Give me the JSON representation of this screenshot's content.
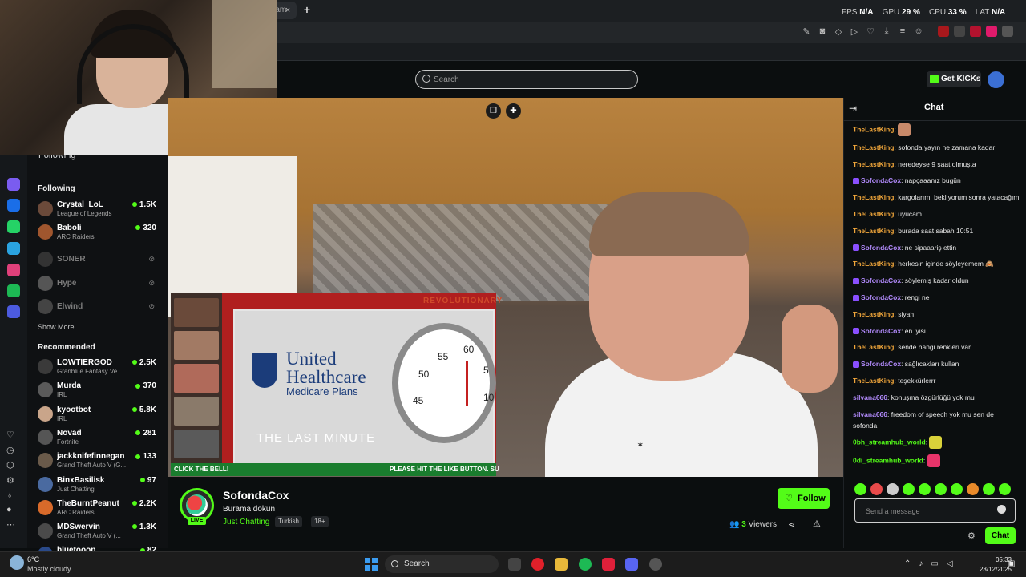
{
  "browser": {
    "tab_label": "ram",
    "tab_close": "×",
    "new_tab": "+",
    "stats": {
      "fps_label": "FPS",
      "fps_value": "N/A",
      "gpu_label": "GPU",
      "gpu_value": "29 %",
      "cpu_label": "CPU",
      "cpu_value": "33 %",
      "lat_label": "LAT",
      "lat_value": "N/A"
    }
  },
  "header": {
    "search_placeholder": "Search",
    "get_kicks": "Get KICKs"
  },
  "sidebar": {
    "following_top": "Following",
    "following_title": "Following",
    "following": [
      {
        "name": "Crystal_LoL",
        "category": "League of Legends",
        "viewers": "1.5K",
        "avatar_color": "#6b4a3a"
      },
      {
        "name": "Baboli",
        "category": "ARC Raiders",
        "viewers": "320",
        "avatar_color": "#a0562e"
      }
    ],
    "offline": [
      {
        "name": "SONER",
        "avatar_color": "#333333"
      },
      {
        "name": "Hype",
        "avatar_color": "#555555"
      },
      {
        "name": "Elwind",
        "avatar_color": "#444444"
      }
    ],
    "show_more": "Show More",
    "recommended_title": "Recommended",
    "recommended": [
      {
        "name": "LOWTIERGOD",
        "category": "Granblue Fantasy Ve...",
        "viewers": "2.5K",
        "avatar_color": "#3a3a3a"
      },
      {
        "name": "Murda",
        "category": "IRL",
        "viewers": "370",
        "avatar_color": "#5a5a5a"
      },
      {
        "name": "kyootbot",
        "category": "IRL",
        "viewers": "5.8K",
        "avatar_color": "#c9a58a"
      },
      {
        "name": "Novad",
        "category": "Fortnite",
        "viewers": "281",
        "avatar_color": "#555555"
      },
      {
        "name": "jackknifefinnegan",
        "category": "Grand Theft Auto V (G...",
        "viewers": "133",
        "avatar_color": "#6a5a4a"
      },
      {
        "name": "BinxBasilisk",
        "category": "Just Chatting",
        "viewers": "97",
        "avatar_color": "#4a6aa0"
      },
      {
        "name": "TheBurntPeanut",
        "category": "ARC Raiders",
        "viewers": "2.2K",
        "avatar_color": "#d86a2a"
      },
      {
        "name": "MDSwervin",
        "category": "Grand Theft Auto V (...",
        "viewers": "1.3K",
        "avatar_color": "#4a4a4a"
      },
      {
        "name": "bluetooop",
        "category": "",
        "viewers": "82",
        "avatar_color": "#2a4a8a"
      }
    ]
  },
  "overlay": {
    "brand_line1": "United",
    "brand_line2": "Healthcare",
    "plans": "Medicare Plans",
    "last_minute": "THE LAST MINUTE",
    "revolutionary": "REVOLUTIONARY",
    "ticker_left": "CLICK THE BELL!",
    "ticker_right": "PLEASE HIT THE LIKE BUTTON. SU",
    "dial": [
      "55",
      "60",
      "50",
      "5",
      "45",
      "10"
    ]
  },
  "stream": {
    "live": "LIVE",
    "streamer": "SofondaCox",
    "title": "Burama dokun",
    "category": "Just Chatting",
    "tags": [
      "Turkish",
      "18+"
    ],
    "follow": "Follow",
    "viewers_count": "3",
    "viewers_label": "Viewers"
  },
  "chat": {
    "title": "Chat",
    "messages": [
      {
        "user": "TheLastKing",
        "color": "orange",
        "text": "",
        "badge": false,
        "emote": "#c98a6a"
      },
      {
        "user": "TheLastKing",
        "color": "orange",
        "text": "sofonda yayın ne zamana kadar",
        "badge": false
      },
      {
        "user": "TheLastKing",
        "color": "orange",
        "text": "neredeyse 9 saat olmuşta",
        "badge": false
      },
      {
        "user": "SofondaCox",
        "color": "purple",
        "text": "napçaaanız bugün",
        "badge": true
      },
      {
        "user": "TheLastKing",
        "color": "orange",
        "text": "kargolarımı bekliyorum sonra yatacağım",
        "badge": false
      },
      {
        "user": "TheLastKing",
        "color": "orange",
        "text": "uyucam",
        "badge": false
      },
      {
        "user": "TheLastKing",
        "color": "orange",
        "text": "burada saat sabah 10:51",
        "badge": false
      },
      {
        "user": "SofondaCox",
        "color": "purple",
        "text": "ne sipaaariş ettin",
        "badge": true
      },
      {
        "user": "TheLastKing",
        "color": "orange",
        "text": "herkesin içinde söyleyemem 🙈",
        "badge": false
      },
      {
        "user": "SofondaCox",
        "color": "purple",
        "text": "söylemiş kadar oldun",
        "badge": true
      },
      {
        "user": "SofondaCox",
        "color": "purple",
        "text": "rengi ne",
        "badge": true
      },
      {
        "user": "TheLastKing",
        "color": "orange",
        "text": "siyah",
        "badge": false
      },
      {
        "user": "SofondaCox",
        "color": "purple",
        "text": "en iyisi",
        "badge": true
      },
      {
        "user": "TheLastKing",
        "color": "orange",
        "text": "sende hangi renkleri var",
        "badge": false
      },
      {
        "user": "SofondaCox",
        "color": "purple",
        "text": "sağlıcakları kullan",
        "badge": true
      },
      {
        "user": "TheLastKing",
        "color": "orange",
        "text": "teşekkürlerrr",
        "badge": false
      },
      {
        "user": "silvana666",
        "color": "purple",
        "text": "konuşma özgürlüğü yok mu",
        "badge": false
      },
      {
        "user": "silvana666",
        "color": "purple",
        "text": "freedom of speech yok mu sen de sofonda",
        "badge": false
      },
      {
        "user": "0bh_streamhub_world",
        "color": "green",
        "text": "",
        "badge": false,
        "emote": "#d9d23a"
      },
      {
        "user": "0di_streamhub_world",
        "color": "green",
        "text": "",
        "badge": false,
        "emote": "#e8346a"
      }
    ],
    "emote_colors": [
      "#53fc18",
      "#e84a4a",
      "#cccccc",
      "#53fc18",
      "#53fc18",
      "#53fc18",
      "#53fc18",
      "#e88a2a",
      "#53fc18",
      "#53fc18"
    ],
    "input_placeholder": "Send a message",
    "send": "Chat"
  },
  "taskbar": {
    "temp": "6°C",
    "weather": "Mostly cloudy",
    "search": "Search",
    "time": "05:33",
    "date": "23/12/2025"
  }
}
